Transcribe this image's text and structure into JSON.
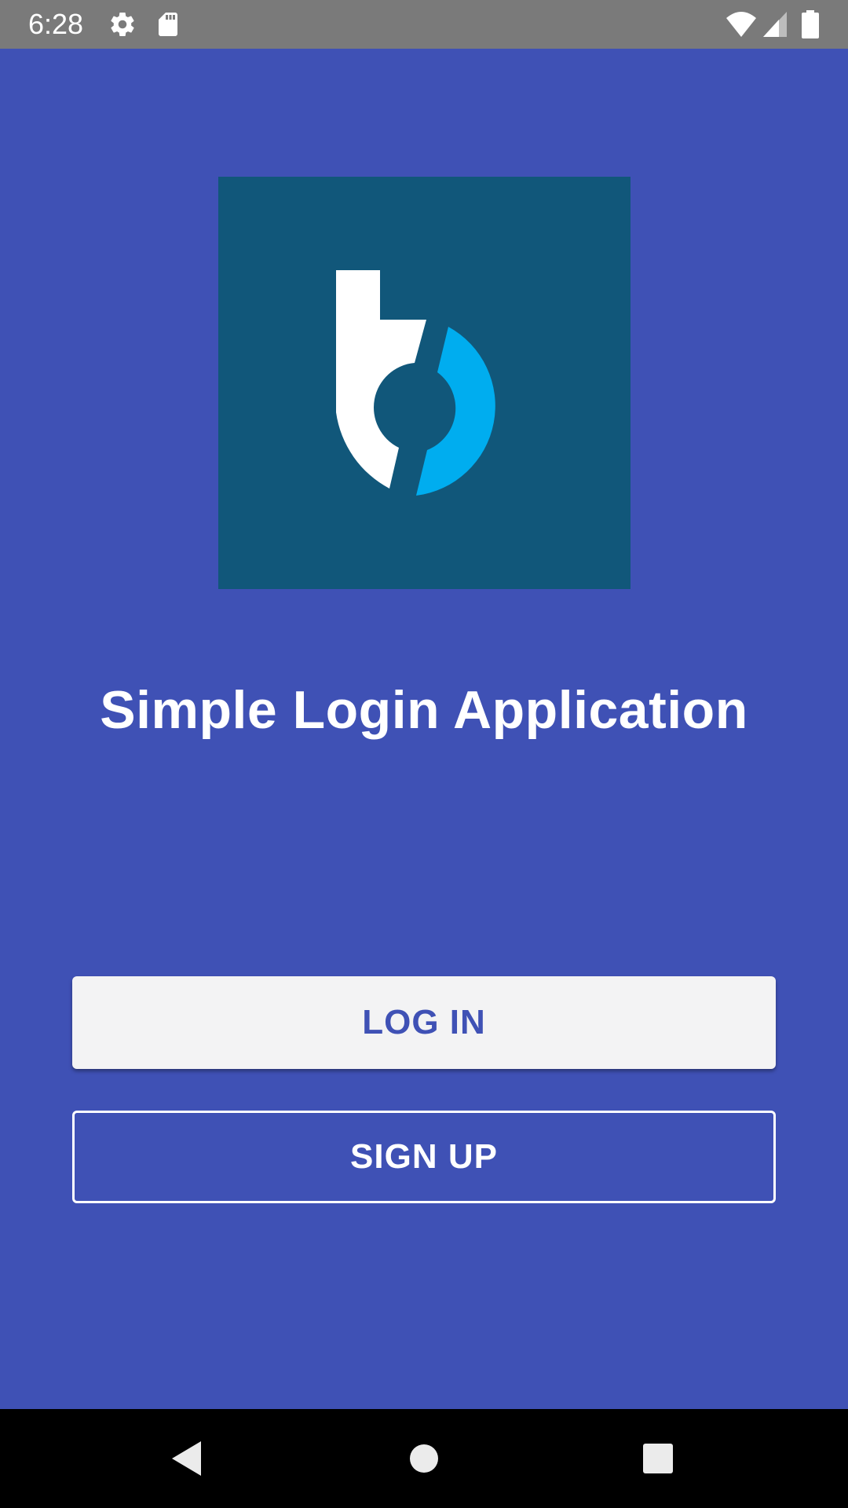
{
  "status_bar": {
    "time": "6:28",
    "icons": [
      "gear-icon",
      "sd-card-icon",
      "wifi-icon",
      "cell-signal-icon",
      "battery-icon"
    ]
  },
  "logo": {
    "background_color": "#11577a",
    "accent_color": "#00adef"
  },
  "app": {
    "title": "Simple Login Application"
  },
  "buttons": {
    "login_label": "LOG IN",
    "signup_label": "SIGN UP"
  },
  "nav_bar": {
    "icons": [
      "back-icon",
      "home-icon",
      "recents-icon"
    ]
  },
  "colors": {
    "primary": "#3f51b5",
    "status_bar": "#7a7a7a",
    "button_light": "#f3f3f4"
  }
}
